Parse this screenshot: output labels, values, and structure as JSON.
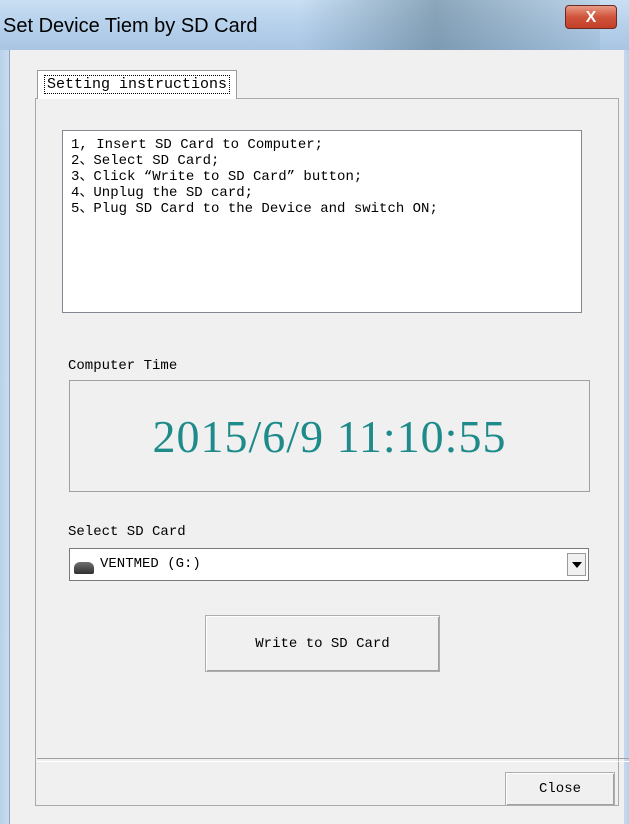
{
  "window": {
    "title": "Set Device Tiem by SD Card",
    "close_glyph": "X"
  },
  "tabs": [
    {
      "label": "Setting instructions"
    }
  ],
  "instructions": [
    "1, Insert SD Card to Computer;",
    "2、Select SD Card;",
    "3、Click “Write to SD Card” button;",
    "4、Unplug the SD card;",
    "5、Plug SD Card to the Device and switch ON;"
  ],
  "computer_time": {
    "label": "Computer Time",
    "value": "2015/6/9 11:10:55",
    "color": "#1e8a8a"
  },
  "sd_card": {
    "label": "Select SD Card",
    "selected": "VENTMED (G:)",
    "icon": "drive-icon"
  },
  "buttons": {
    "write": "Write to SD Card",
    "close": "Close"
  }
}
